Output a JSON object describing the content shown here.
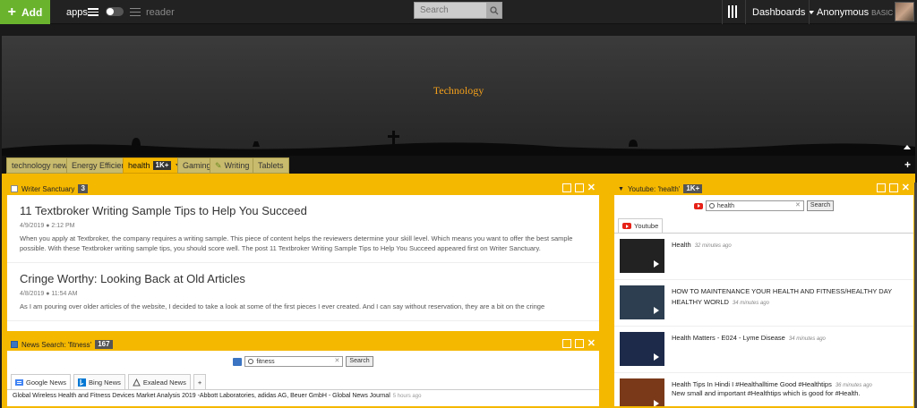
{
  "topbar": {
    "add_label": "Add",
    "apps_label": "apps",
    "reader_label": "reader",
    "search_placeholder": "Search",
    "dashboards_label": "Dashboards",
    "user_name": "Anonymous",
    "user_plan": "BASIC"
  },
  "banner": {
    "title": "Technology"
  },
  "tabs": [
    {
      "label": "technology news"
    },
    {
      "label": "Energy Efficiency"
    },
    {
      "label": "health",
      "badge": "1K+"
    },
    {
      "label": "Gaming"
    },
    {
      "label": "Writing"
    },
    {
      "label": "Tablets"
    }
  ],
  "writer_widget": {
    "title": "Writer Sanctuary",
    "count": "3",
    "articles": [
      {
        "title": "11 Textbroker Writing Sample Tips to Help You Succeed",
        "date": "4/9/2019",
        "time": "2:12 PM",
        "body": "When you apply at Textbroker, the company requires a writing sample. This piece of content helps the reviewers determine your skill level. Which means you want to offer the best sample possible. With these Textbroker writing sample tips, you should score well. The post 11 Textbroker Writing Sample Tips to Help You Succeed appeared first on Writer Sanctuary."
      },
      {
        "title": "Cringe Worthy: Looking Back at Old Articles",
        "date": "4/8/2019",
        "time": "11:54 AM",
        "body": "As I am pouring over older articles of the website, I decided to take a look at some of the first pieces I ever created. And I can say without reservation, they are a bit on the cringe"
      }
    ]
  },
  "news_widget": {
    "title": "News Search: 'fitness'",
    "count": "167",
    "query": "fitness",
    "search_button": "Search",
    "sources": [
      "Google News",
      "Bing News",
      "Exalead News",
      "+"
    ],
    "items": [
      {
        "title": "Global Wireless Health and Fitness Devices Market Analysis 2019 -Abbott Laboratories, adidas AG, Beuer GmbH - Global News Journal",
        "time": "5 hours ago"
      }
    ]
  },
  "youtube_widget": {
    "title": "Youtube: 'health'",
    "count": "1K+",
    "query": "health",
    "search_button": "Search",
    "tab_label": "Youtube",
    "items": [
      {
        "title": "Health",
        "time": "32 minutes ago",
        "line2": ""
      },
      {
        "title": "HOW TO MAINTENANCE YOUR HEALTH AND FITNESS/HEALTHY DAY HEALTHY WORLD",
        "time": "34 minutes ago",
        "line2": ""
      },
      {
        "title": "Health Matters - E024 - Lyme Disease",
        "time": "34 minutes ago",
        "line2": ""
      },
      {
        "title": "Health Tips In Hindi I #Healthalltime Good #Healthtips",
        "time": "36 minutes ago",
        "line2": "New small and important #Healthtips which is good for #Health."
      }
    ]
  },
  "colors": {
    "accent": "#f5b800",
    "add_green": "#6ab42d",
    "banner_title": "#f3a01b"
  }
}
